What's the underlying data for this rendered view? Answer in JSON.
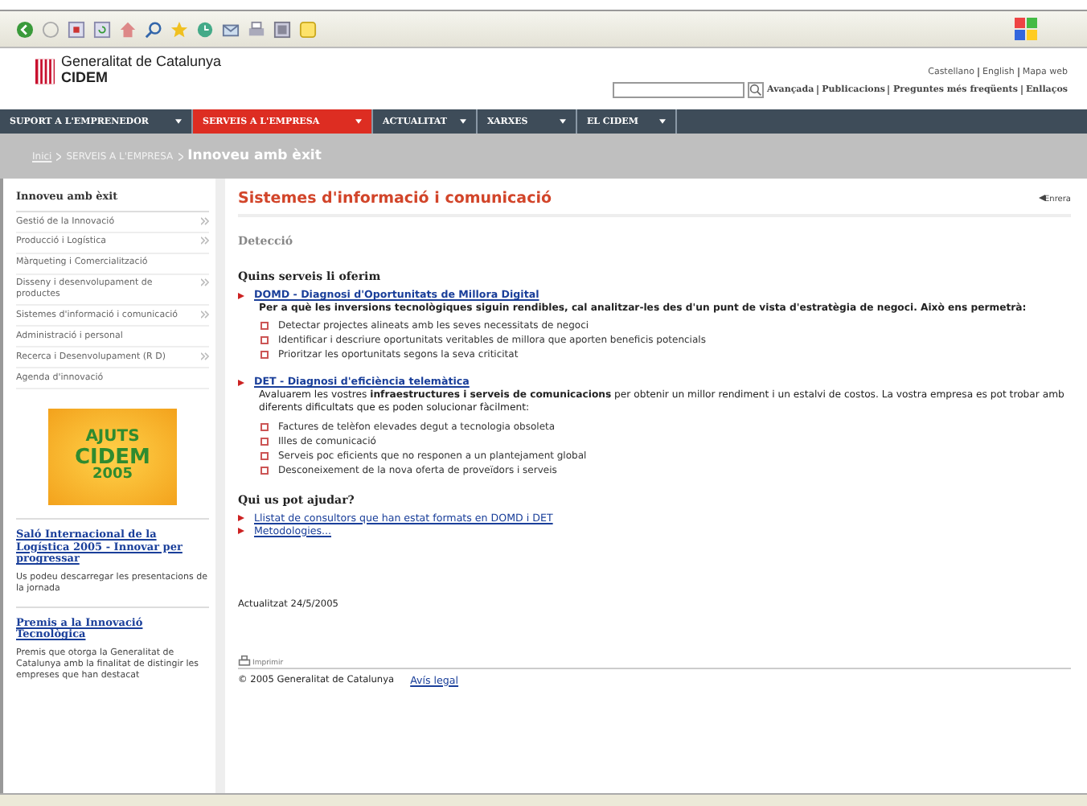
{
  "header": {
    "org": "Generalitat de Catalunya",
    "brand": "CIDEM",
    "languages": [
      "Castellano",
      "English",
      "Mapa web"
    ],
    "links": [
      "Avançada",
      "Publicacions",
      "Preguntes més freqüents",
      "Enllaços"
    ]
  },
  "nav": [
    {
      "label": "SUPORT A L'EMPRENEDOR",
      "selected": false
    },
    {
      "label": "SERVEIS A L'EMPRESA",
      "selected": true
    },
    {
      "label": "ACTUALITAT",
      "selected": false
    },
    {
      "label": "XARXES",
      "selected": false
    },
    {
      "label": "EL CIDEM",
      "selected": false
    }
  ],
  "breadcrumb": {
    "links": [
      "Inici",
      "SERVEIS A L'EMPRESA"
    ],
    "current": "Innoveu amb èxit"
  },
  "sidebar": {
    "title": "Innoveu amb èxit",
    "items": [
      {
        "label": "Gestió de la Innovació",
        "has_submenu": true
      },
      {
        "label": "Producció i Logística",
        "has_submenu": true
      },
      {
        "label": "Màrqueting i Comercialització",
        "has_submenu": false
      },
      {
        "label": "Disseny i desenvolupament de productes",
        "has_submenu": true
      },
      {
        "label": "Sistemes d'informació i comunicació",
        "has_submenu": true
      },
      {
        "label": "Administració i personal",
        "has_submenu": false
      },
      {
        "label": "Recerca i Desenvolupament (R D)",
        "has_submenu": true
      },
      {
        "label": "Agenda d'innovació",
        "has_submenu": false
      }
    ],
    "banner": [
      "AJUTS",
      "CIDEM",
      "2005"
    ],
    "news": [
      {
        "title": "Saló Internacional de la Logística 2005 - Innovar per progressar",
        "text": "Us podeu descarregar les presentacions de la jornada"
      },
      {
        "title": "Premis a la Innovació Tecnològica",
        "text": "Premis que otorga la Generalitat de Catalunya amb la finalitat de distingir les empreses que han destacat"
      }
    ]
  },
  "main": {
    "title": "Sistemes d'informació i comunicació",
    "back": "Enrera",
    "section": "Detecció",
    "heading": "Quins serveis li oferim",
    "services": [
      {
        "link": "DOMD - Diagnosi d'Oportunitats de Millora Digital",
        "intro": "**Per a què les inversions tecnològiques siguin rendibles, cal analitzar-les des d'un punt de vista d'estratègia de negoci. Això ens permetrà:**",
        "points": [
          "Detectar projectes alineats amb les seves necessitats de negoci",
          "Identificar i descriure oportunitats veritables de millora que aporten beneficis potencials",
          "Prioritzar les oportunitats segons la seva criticitat"
        ]
      },
      {
        "link": "DET - Diagnosi d'eficiència telemàtica",
        "intro": "Avaluarem les vostres **infraestructures i serveis de comunicacions**  per obtenir un millor rendiment i un estalvi de costos. La vostra empresa es pot trobar amb diferents dificultats que es poden solucionar fàcilment:",
        "points": [
          "Factures de telèfon elevades degut a tecnologia obsoleta",
          "Illes de comunicació",
          "Serveis poc eficients que no responen a un plantejament global",
          "Desconeixement de la nova oferta de proveïdors i serveis"
        ]
      }
    ],
    "help_heading": "Qui us pot ajudar?",
    "help_links": [
      "Llistat de consultors que han estat formats en DOMD i DET",
      "Metodologies..."
    ],
    "updated": "Actualitzat 24/5/2005",
    "print": "Imprimir",
    "copyright": "© 2005 Generalitat de Catalunya",
    "legal": "Avís legal"
  }
}
